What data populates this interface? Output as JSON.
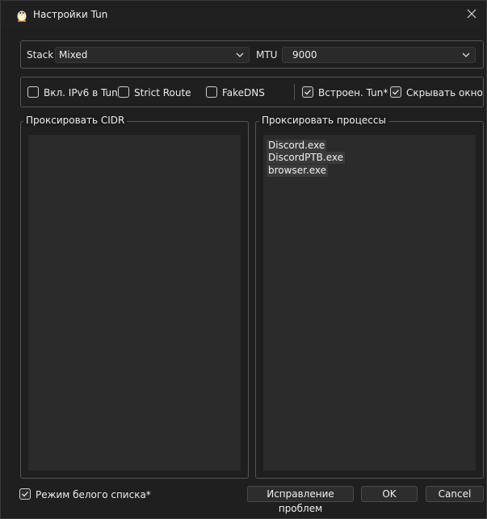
{
  "window": {
    "title": "Настройки Tun"
  },
  "stack": {
    "label": "Stack",
    "value": "Mixed"
  },
  "mtu": {
    "label": "MTU",
    "value": "9000"
  },
  "options": [
    {
      "label": "Вкл. IPv6 в Tun",
      "checked": false
    },
    {
      "label": "Strict Route",
      "checked": false
    },
    {
      "label": "FakeDNS",
      "checked": false
    },
    {
      "label": "Встроен. Tun*",
      "checked": true
    },
    {
      "label": "Скрывать окно",
      "checked": true
    }
  ],
  "cidr": {
    "title": "Проксировать CIDR"
  },
  "processes": {
    "title": "Проксировать процессы",
    "items": [
      "Discord.exe",
      "DiscordPTB.exe",
      "browser.exe"
    ]
  },
  "whitelist": {
    "label": "Режим белого списка*",
    "checked": true
  },
  "buttons": {
    "fix": "Исправление проблем",
    "ok": "OK",
    "cancel": "Cancel"
  },
  "icons": {
    "app": "penguin-icon",
    "close": "close-icon",
    "dropdown": "chevron-down-icon",
    "check": "checkmark-icon"
  }
}
